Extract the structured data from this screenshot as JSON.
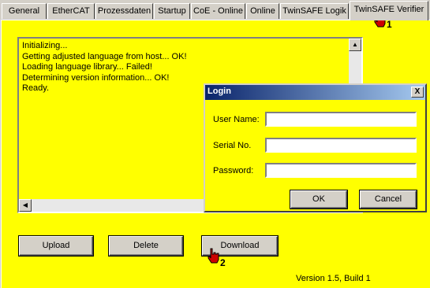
{
  "tabs": [
    {
      "label": "General"
    },
    {
      "label": "EtherCAT"
    },
    {
      "label": "Prozessdaten"
    },
    {
      "label": "Startup"
    },
    {
      "label": "CoE - Online"
    },
    {
      "label": "Online"
    },
    {
      "label": "TwinSAFE Logik"
    },
    {
      "label": "TwinSAFE Verifier",
      "active": true
    }
  ],
  "log": {
    "lines": [
      "Initializing...",
      "Getting adjusted language from host... OK!",
      "Loading language library... Failed!",
      "Determining version information... OK!",
      "Ready."
    ]
  },
  "buttons": {
    "upload": "Upload",
    "delete": "Delete",
    "download": "Download"
  },
  "version": "Version 1.5, Build 1",
  "dialog": {
    "title": "Login",
    "close": "X",
    "fields": [
      {
        "label": "User Name:",
        "value": ""
      },
      {
        "label": "Serial No.",
        "value": ""
      },
      {
        "label": "Password:",
        "value": ""
      }
    ],
    "ok": "OK",
    "cancel": "Cancel"
  },
  "markers": [
    {
      "number": "1",
      "icon": "pointing-hand-icon"
    },
    {
      "number": "2",
      "icon": "pointing-hand-icon"
    }
  ],
  "colors": {
    "panel_bg": "#ffff00",
    "chrome": "#d4d0c8",
    "titlebar": "#0a246a",
    "marker": "#cc0000"
  }
}
